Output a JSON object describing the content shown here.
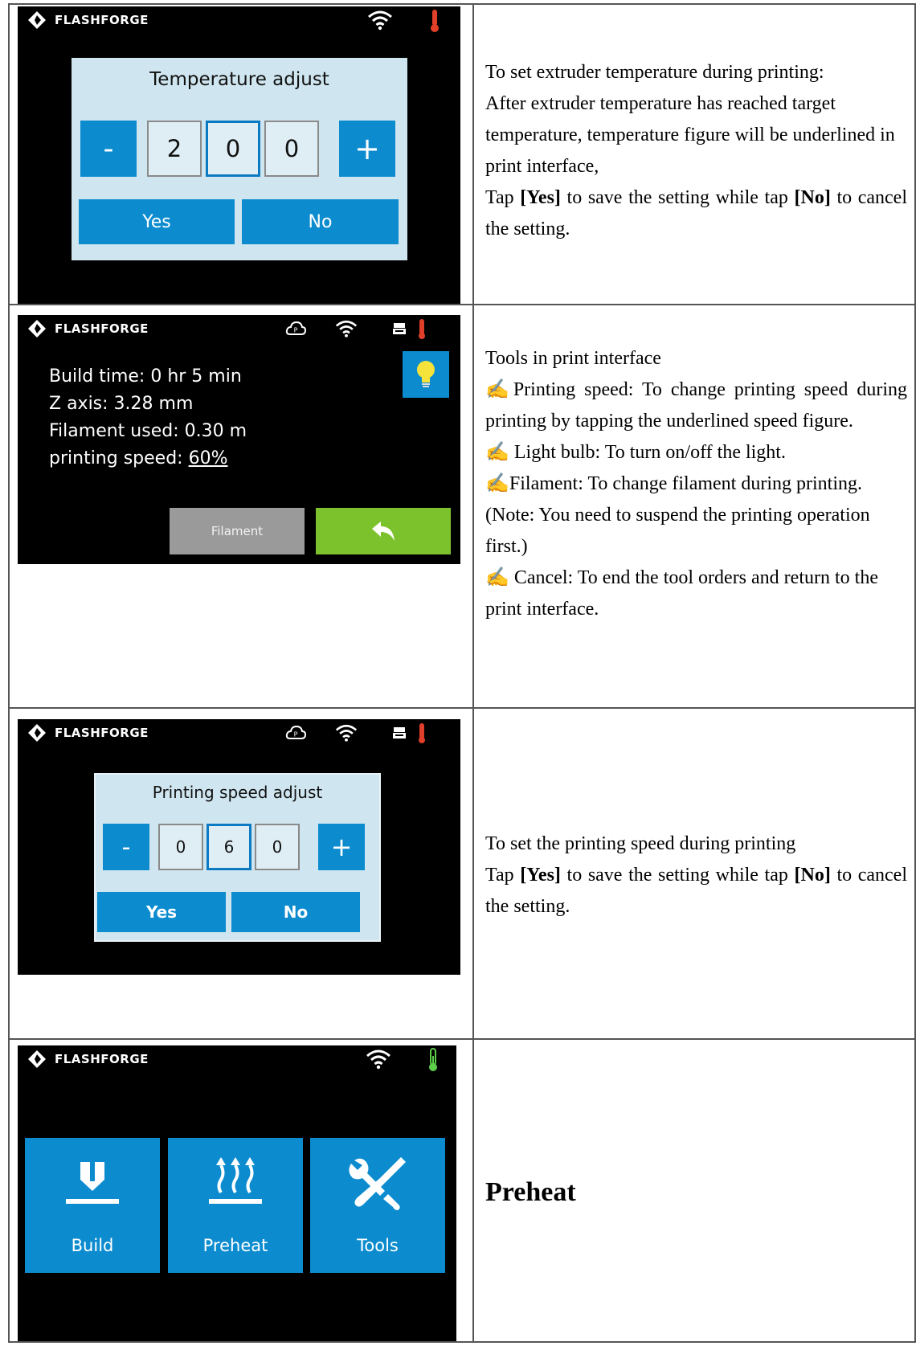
{
  "brand": "FLASHFORGE",
  "row1": {
    "dialog_title": "Temperature adjust",
    "minus": "-",
    "plus": "+",
    "digits": [
      "2",
      "0",
      "0"
    ],
    "yes": "Yes",
    "no": "No",
    "desc": {
      "line1": "To set extruder temperature during printing:",
      "line2": "After extruder temperature has reached target temperature, temperature figure will be underlined in print interface,",
      "tap": "Tap ",
      "yes_b": "[Yes]",
      "mid": " to save the setting while tap ",
      "no_b": "[No]",
      "end": " to cancel the setting."
    }
  },
  "row2": {
    "build_time": "Build time: 0 hr 5 min",
    "z_axis": "Z axis: 3.28 mm",
    "filament_used": "Filament used: 0.30 m",
    "speed_label": "printing speed: ",
    "speed_value": "60%",
    "filament_btn": "Filament",
    "desc": {
      "title": "Tools in print interface",
      "b1": "✍Printing speed: To change printing speed during printing by tapping the underlined speed figure.",
      "b2": "✍ Light bulb: To turn on/off the light.",
      "b3": "✍Filament: To change filament during printing. (Note: You need to suspend the printing operation first.)",
      "b4": "✍ Cancel: To end the tool orders and return to the print interface."
    }
  },
  "row3": {
    "dialog_title": "Printing speed adjust",
    "minus": "-",
    "plus": "+",
    "digits": [
      "0",
      "6",
      "0"
    ],
    "yes": "Yes",
    "no": "No",
    "desc": {
      "line1": "To set the printing speed during printing",
      "tap": "Tap ",
      "yes_b": "[Yes]",
      "mid": " to save the setting while tap ",
      "no_b": "[No]",
      "end": " to cancel the setting."
    }
  },
  "row4": {
    "tiles": [
      "Build",
      "Preheat",
      "Tools"
    ],
    "title": "Preheat"
  },
  "colors": {
    "screen_bg": "#000000",
    "dialog_bg": "#cfe6f0",
    "button_blue": "#0c8ccf",
    "button_green": "#7cc22c",
    "button_gray": "#9a9a9a",
    "thermo_red": "#e0402a",
    "thermo_green": "#5bd048"
  },
  "icons": [
    "brand-logo-icon",
    "wifi-icon",
    "thermometer-icon",
    "cloud-p-icon",
    "printer-icon",
    "lightbulb-icon",
    "back-arrow-icon",
    "build-icon",
    "preheat-icon",
    "tools-icon"
  ]
}
